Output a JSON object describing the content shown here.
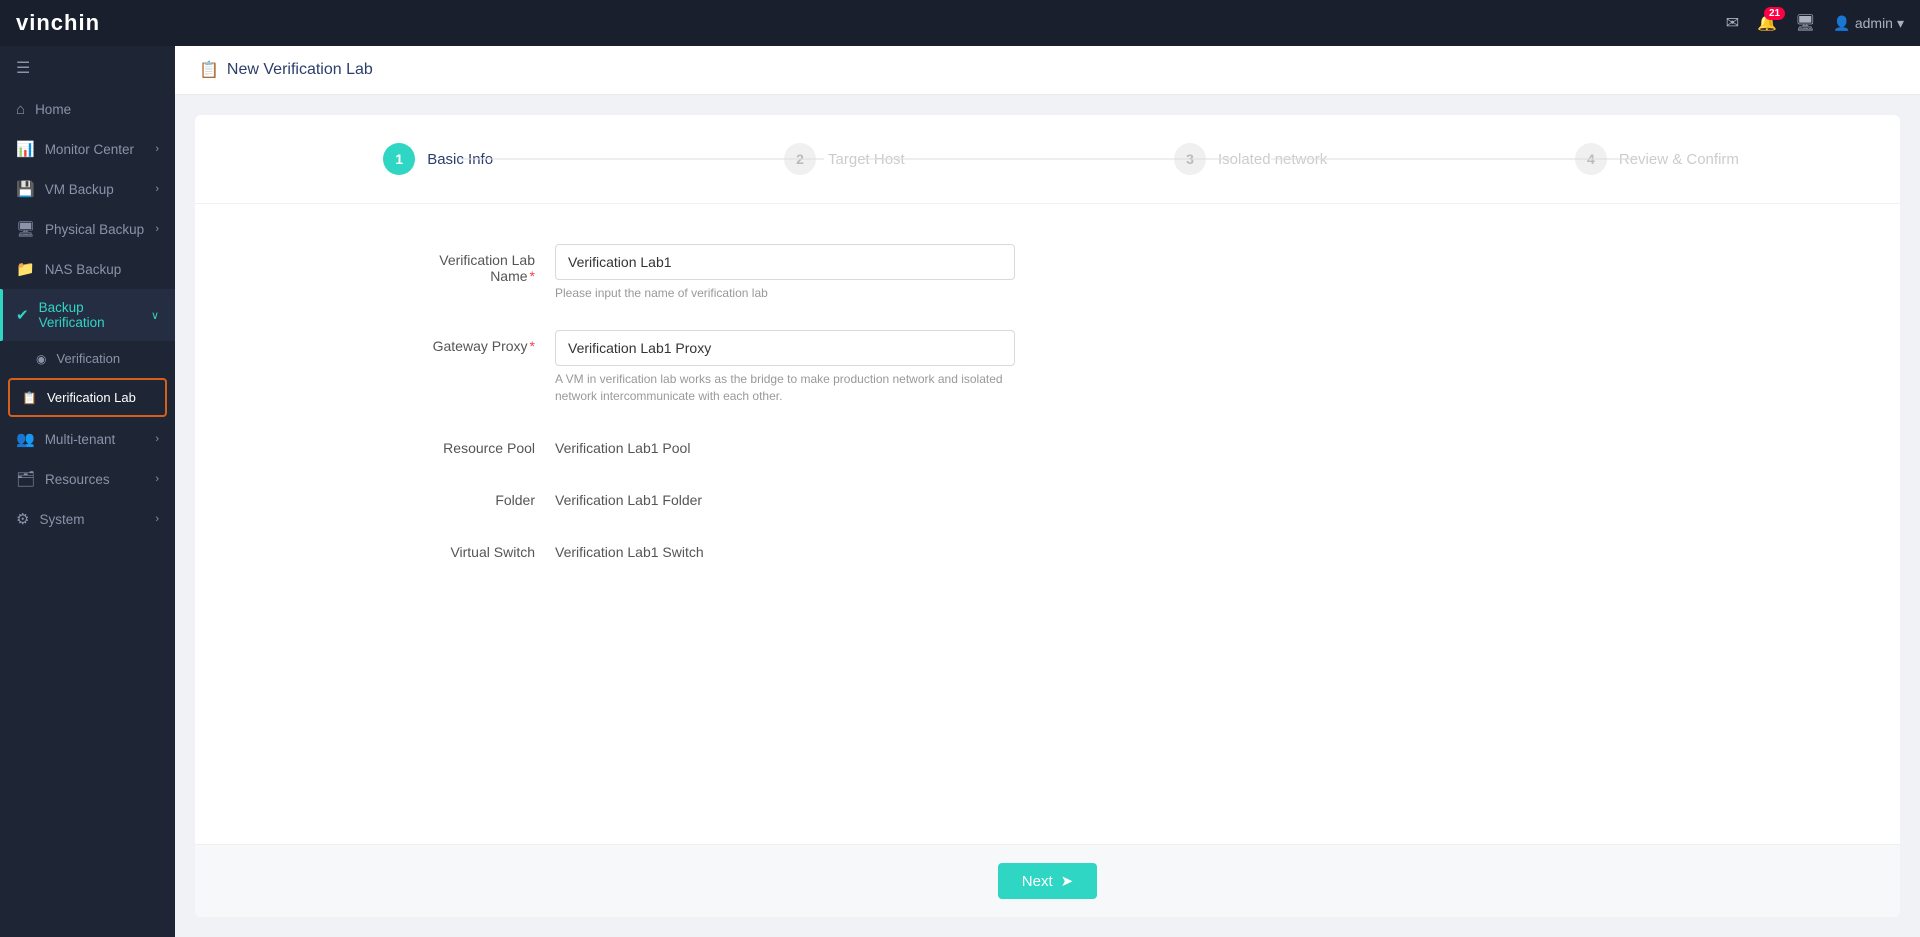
{
  "app": {
    "logo_v": "vin",
    "logo_chin": "chin",
    "notification_count": "21"
  },
  "topbar": {
    "user_label": "admin",
    "chevron": "▾"
  },
  "sidebar": {
    "toggle_icon": "☰",
    "items": [
      {
        "id": "home",
        "icon": "⌂",
        "label": "Home",
        "active": false,
        "has_chevron": false
      },
      {
        "id": "monitor-center",
        "icon": "📊",
        "label": "Monitor Center",
        "active": false,
        "has_chevron": true
      },
      {
        "id": "vm-backup",
        "icon": "💾",
        "label": "VM Backup",
        "active": false,
        "has_chevron": true
      },
      {
        "id": "physical-backup",
        "icon": "🖥",
        "label": "Physical Backup",
        "active": false,
        "has_chevron": true
      },
      {
        "id": "nas-backup",
        "icon": "📁",
        "label": "NAS Backup",
        "active": false,
        "has_chevron": false
      },
      {
        "id": "backup-verification",
        "icon": "✔",
        "label": "Backup Verification",
        "active": true,
        "has_chevron": true
      },
      {
        "id": "multi-tenant",
        "icon": "👥",
        "label": "Multi-tenant",
        "active": false,
        "has_chevron": true
      },
      {
        "id": "resources",
        "icon": "🗂",
        "label": "Resources",
        "active": false,
        "has_chevron": true
      },
      {
        "id": "system",
        "icon": "⚙",
        "label": "System",
        "active": false,
        "has_chevron": true
      }
    ],
    "subitems": {
      "backup-verification": [
        {
          "id": "verification",
          "label": "Verification",
          "highlighted": false
        },
        {
          "id": "verification-lab",
          "label": "Verification Lab",
          "highlighted": true
        }
      ]
    }
  },
  "page": {
    "header_icon": "📋",
    "title": "New Verification Lab"
  },
  "wizard": {
    "steps": [
      {
        "number": "1",
        "label": "Basic Info",
        "active": true
      },
      {
        "number": "2",
        "label": "Target Host",
        "active": false
      },
      {
        "number": "3",
        "label": "Isolated network",
        "active": false
      },
      {
        "number": "4",
        "label": "Review & Confirm",
        "active": false
      }
    ],
    "form": {
      "lab_name_label": "Verification Lab Name",
      "lab_name_required": "*",
      "lab_name_value": "Verification Lab1",
      "lab_name_placeholder": "Please input the name of verification lab",
      "lab_name_hint": "Please input the name of verification lab",
      "gateway_proxy_label": "Gateway Proxy",
      "gateway_proxy_required": "*",
      "gateway_proxy_value": "Verification Lab1 Proxy",
      "gateway_proxy_hint": "A VM in verification lab works as the bridge to make production network and isolated network intercommunicate with each other.",
      "resource_pool_label": "Resource Pool",
      "resource_pool_value": "Verification Lab1 Pool",
      "folder_label": "Folder",
      "folder_value": "Verification Lab1 Folder",
      "virtual_switch_label": "Virtual Switch",
      "virtual_switch_value": "Verification Lab1 Switch"
    },
    "footer": {
      "next_label": "Next",
      "next_icon": "➤"
    }
  }
}
